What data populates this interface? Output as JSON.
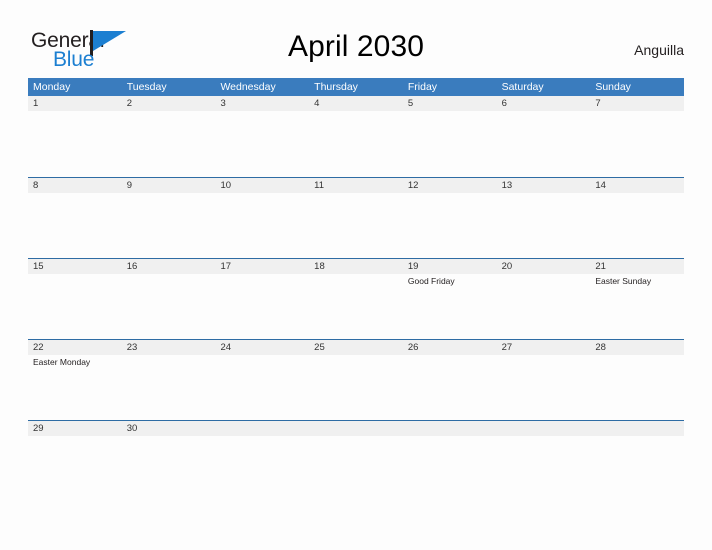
{
  "brand": {
    "name_part1": "General",
    "name_part2": "Blue"
  },
  "header": {
    "title": "April 2030",
    "region": "Anguilla"
  },
  "calendar": {
    "weekdays": [
      "Monday",
      "Tuesday",
      "Wednesday",
      "Thursday",
      "Friday",
      "Saturday",
      "Sunday"
    ],
    "colors": {
      "header_blue": "#3a7cbe",
      "row_rule": "#2e6ca4",
      "date_band": "#f0f0f0",
      "brand_blue": "#1c7fd1"
    },
    "weeks": [
      {
        "days": [
          {
            "num": "1",
            "events": []
          },
          {
            "num": "2",
            "events": []
          },
          {
            "num": "3",
            "events": []
          },
          {
            "num": "4",
            "events": []
          },
          {
            "num": "5",
            "events": []
          },
          {
            "num": "6",
            "events": []
          },
          {
            "num": "7",
            "events": []
          }
        ]
      },
      {
        "days": [
          {
            "num": "8",
            "events": []
          },
          {
            "num": "9",
            "events": []
          },
          {
            "num": "10",
            "events": []
          },
          {
            "num": "11",
            "events": []
          },
          {
            "num": "12",
            "events": []
          },
          {
            "num": "13",
            "events": []
          },
          {
            "num": "14",
            "events": []
          }
        ]
      },
      {
        "days": [
          {
            "num": "15",
            "events": []
          },
          {
            "num": "16",
            "events": []
          },
          {
            "num": "17",
            "events": []
          },
          {
            "num": "18",
            "events": []
          },
          {
            "num": "19",
            "events": [
              "Good Friday"
            ]
          },
          {
            "num": "20",
            "events": []
          },
          {
            "num": "21",
            "events": [
              "Easter Sunday"
            ]
          }
        ]
      },
      {
        "days": [
          {
            "num": "22",
            "events": [
              "Easter Monday"
            ]
          },
          {
            "num": "23",
            "events": []
          },
          {
            "num": "24",
            "events": []
          },
          {
            "num": "25",
            "events": []
          },
          {
            "num": "26",
            "events": []
          },
          {
            "num": "27",
            "events": []
          },
          {
            "num": "28",
            "events": []
          }
        ]
      },
      {
        "days": [
          {
            "num": "29",
            "events": []
          },
          {
            "num": "30",
            "events": []
          },
          {
            "num": "",
            "events": []
          },
          {
            "num": "",
            "events": []
          },
          {
            "num": "",
            "events": []
          },
          {
            "num": "",
            "events": []
          },
          {
            "num": "",
            "events": []
          }
        ]
      }
    ]
  }
}
